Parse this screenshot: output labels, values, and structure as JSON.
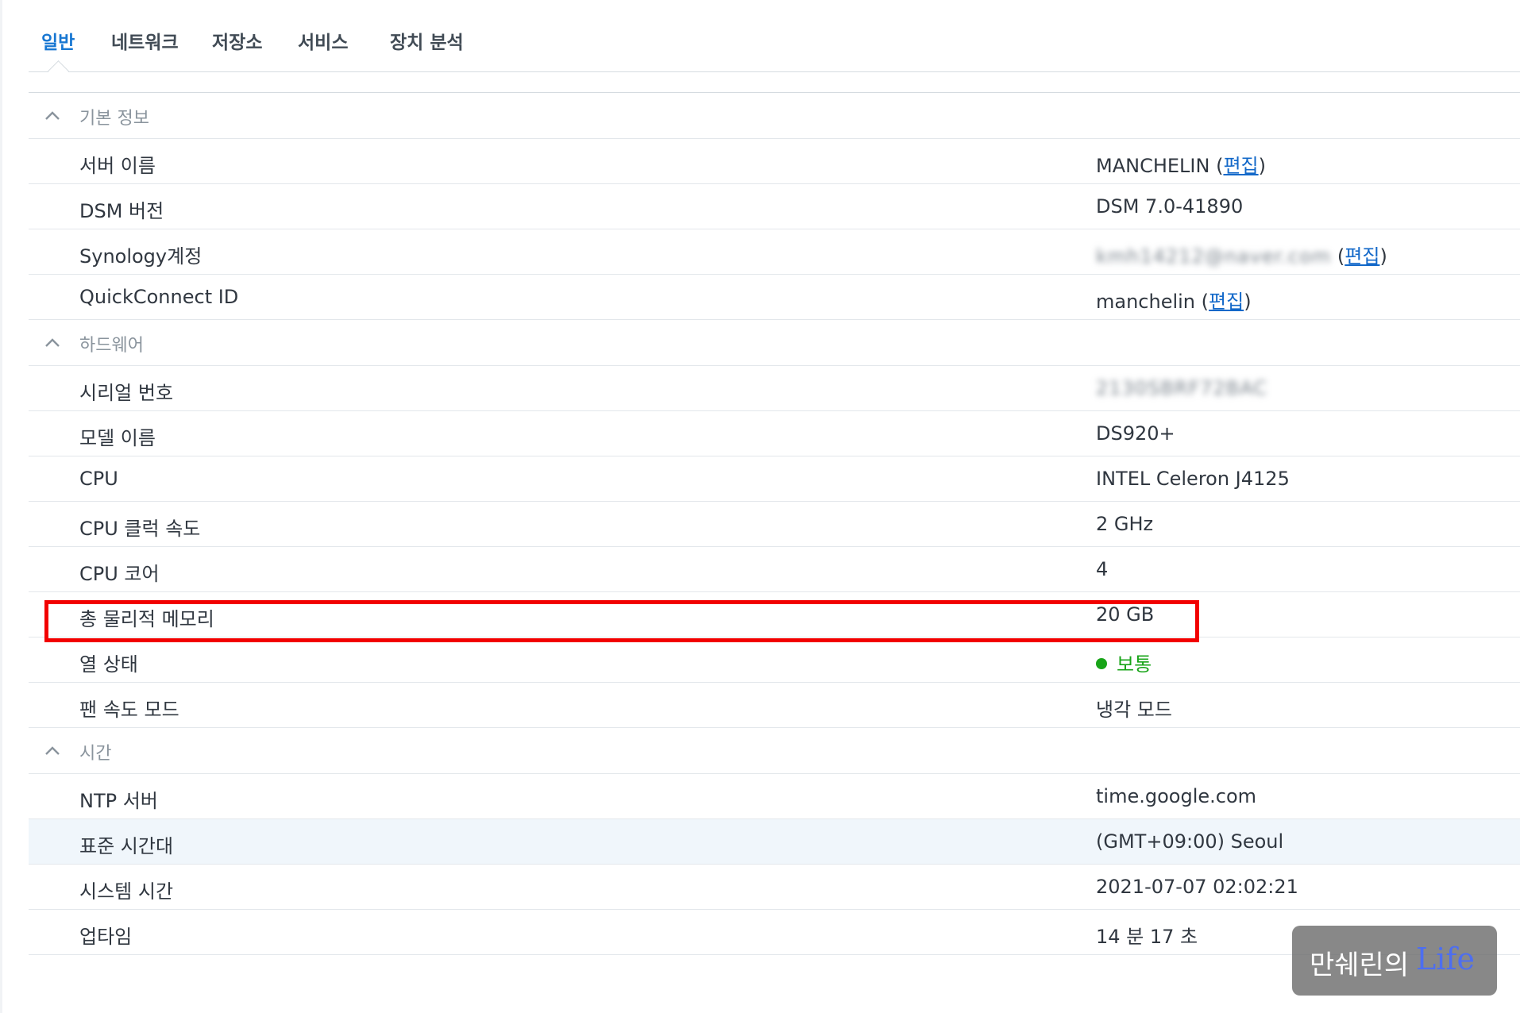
{
  "tabs": [
    {
      "label": "일반",
      "active": true
    },
    {
      "label": "네트워크",
      "active": false
    },
    {
      "label": "저장소",
      "active": false
    },
    {
      "label": "서비스",
      "active": false
    },
    {
      "label": "장치 분석",
      "active": false
    }
  ],
  "sections": {
    "basic": "기본 정보",
    "hardware": "하드웨어",
    "time": "시간"
  },
  "basic": {
    "server_name": {
      "label": "서버 이름",
      "value": "MANCHELIN",
      "edit": "편집"
    },
    "dsm_version": {
      "label": "DSM 버전",
      "value": "DSM 7.0-41890"
    },
    "synology_account": {
      "label": "Synology계정",
      "value": "kmh14212@naver.com",
      "edit": "편집"
    },
    "quickconnect": {
      "label": "QuickConnect ID",
      "value": "manchelin",
      "edit": "편집"
    }
  },
  "hardware": {
    "serial": {
      "label": "시리얼 번호",
      "value": "2130SBRF72BAC"
    },
    "model": {
      "label": "모델 이름",
      "value": "DS920+"
    },
    "cpu": {
      "label": "CPU",
      "value": "INTEL Celeron J4125"
    },
    "cpu_clock": {
      "label": "CPU 클럭 속도",
      "value": "2 GHz"
    },
    "cpu_cores": {
      "label": "CPU 코어",
      "value": "4"
    },
    "memory": {
      "label": "총 물리적 메모리",
      "value": "20 GB"
    },
    "thermal": {
      "label": "열 상태",
      "value": "보통",
      "status_color": "#18a418"
    },
    "fan_mode": {
      "label": "팬 속도 모드",
      "value": "냉각 모드"
    }
  },
  "time": {
    "ntp": {
      "label": "NTP 서버",
      "value": "time.google.com"
    },
    "timezone": {
      "label": "표준 시간대",
      "value": "(GMT+09:00) Seoul"
    },
    "system_time": {
      "label": "시스템 시간",
      "value": "2021-07-07 02:02:21"
    },
    "uptime": {
      "label": "업타임",
      "value": "14 분 17 초"
    }
  },
  "watermark": {
    "main": "만쉐린의",
    "accent": "Life"
  },
  "colors": {
    "accent": "#1877d2",
    "link": "#1268c9",
    "highlight": "#f20000",
    "ok": "#18a418"
  }
}
